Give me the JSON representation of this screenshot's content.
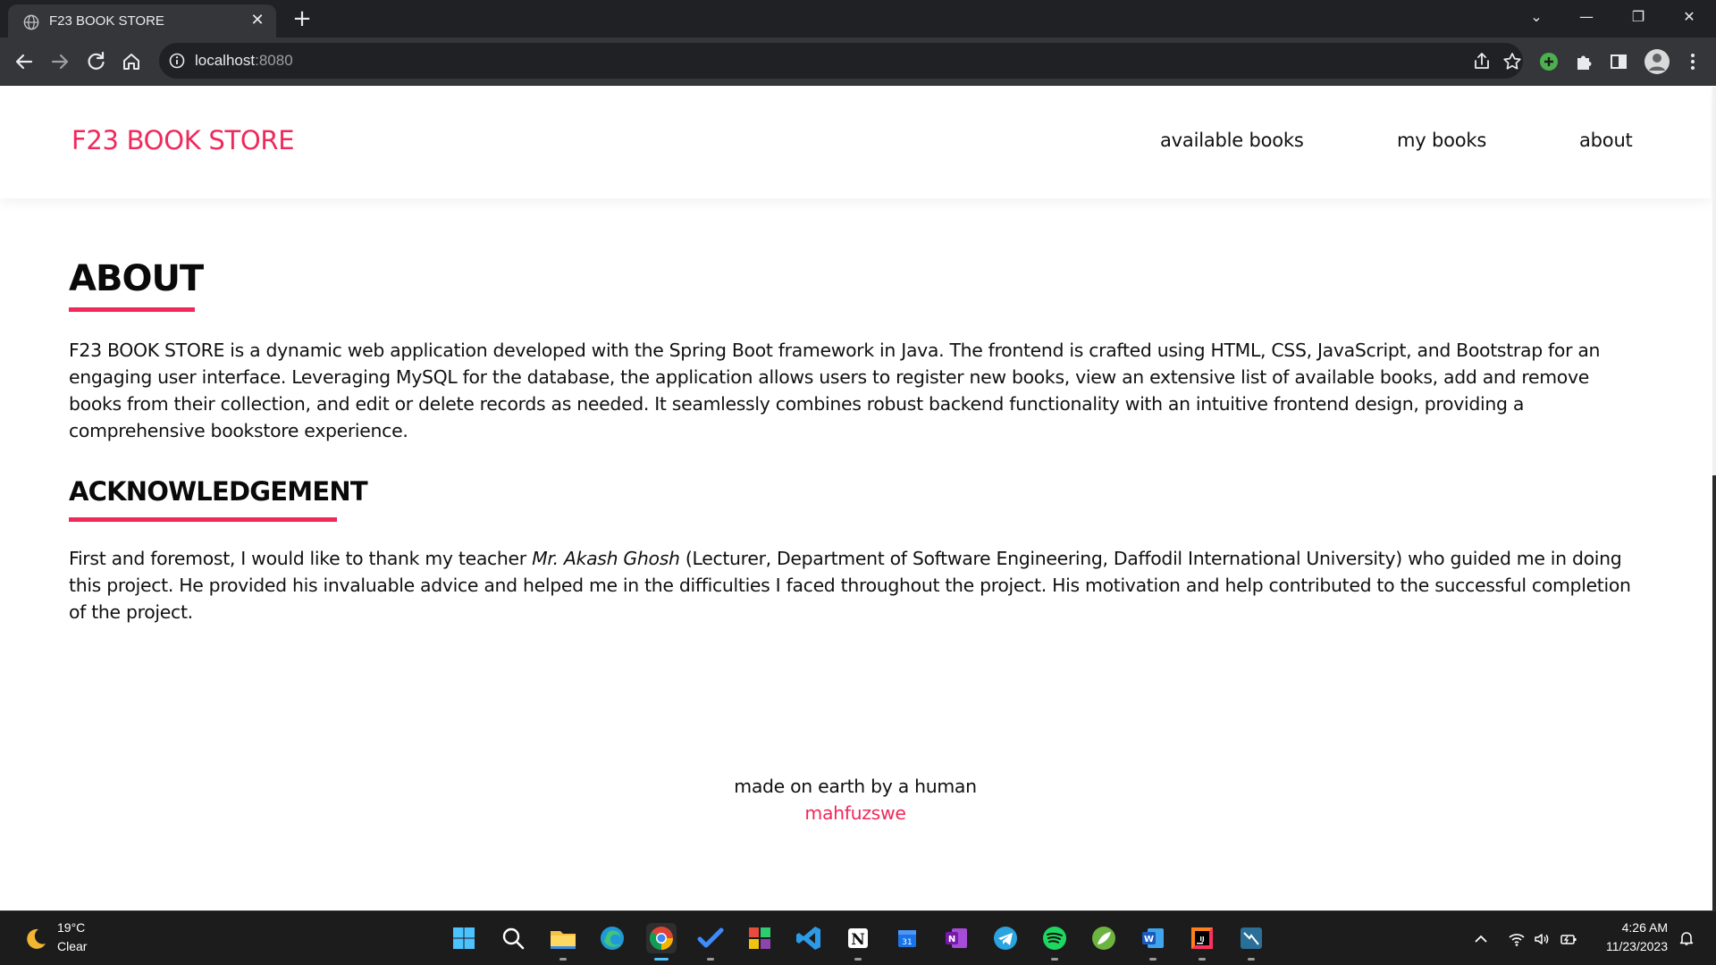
{
  "browser": {
    "tab_title": "F23 BOOK STORE",
    "url_host": "localhost",
    "url_port": ":8080"
  },
  "site": {
    "brand": "F23 BOOK STORE",
    "nav": [
      {
        "label": "available books"
      },
      {
        "label": "my books"
      },
      {
        "label": "about"
      }
    ]
  },
  "about": {
    "heading": "ABOUT",
    "text": "F23 BOOK STORE is a dynamic web application developed with the Spring Boot framework in Java. The frontend is crafted using HTML, CSS, JavaScript, and Bootstrap for an engaging user interface. Leveraging MySQL for the database, the application allows users to register new books, view an extensive list of available books, add and remove books from their collection, and edit or delete records as needed. It seamlessly combines robust backend functionality with an intuitive frontend design, providing a comprehensive bookstore experience."
  },
  "acknowledgement": {
    "heading": "ACKNOWLEDGEMENT",
    "text_before": "First and foremost, I would like to thank my teacher ",
    "teacher": "Mr. Akash Ghosh",
    "text_after": " (Lecturer, Department of Software Engineering, Daffodil International University) who guided me in doing this project. He provided his invaluable advice and helped me in the difficulties I faced throughout the project. His motivation and help contributed to the successful completion of the project."
  },
  "footer": {
    "line1": "made on earth by a human",
    "author": "mahfuzswe"
  },
  "taskbar": {
    "temperature": "19°C",
    "condition": "Clear",
    "time": "4:26 AM",
    "date": "11/23/2023",
    "apps": [
      "start-icon",
      "search-icon",
      "file-explorer-icon",
      "edge-icon",
      "chrome-icon",
      "todo-icon",
      "office-icon",
      "vscode-icon",
      "notion-icon",
      "calendar-icon",
      "onenote-icon",
      "telegram-icon",
      "spotify-icon",
      "spring-icon",
      "word-icon",
      "intellij-icon",
      "mysql-workbench-icon"
    ]
  },
  "colors": {
    "accent": "#f0295b",
    "chrome_dark": "#202124",
    "chrome_toolbar": "#35363a"
  }
}
